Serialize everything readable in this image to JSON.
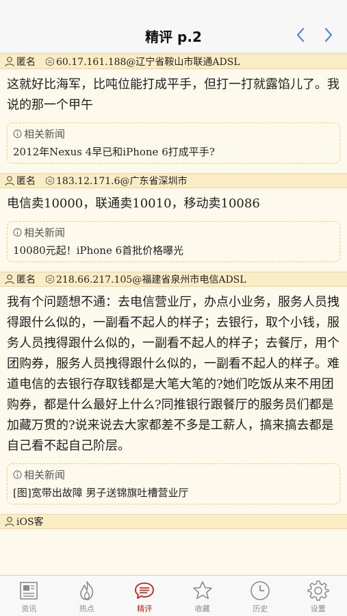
{
  "header": {
    "title": "精评 p.2"
  },
  "comments": [
    {
      "user": "匿名",
      "location": "60.17.161.188@辽宁省鞍山市联通ADSL",
      "text": "这就好比海军，比吨位能打成平手，但打一打就露馅儿了。我说的那一个甲午",
      "related_label": "相关新闻",
      "related_title": "2012年Nexus 4早已和iPhone 6打成平手?"
    },
    {
      "user": "匿名",
      "location": "183.12.171.6@广东省深圳市",
      "text": "电信卖10000，联通卖10010，移动卖10086",
      "related_label": "相关新闻",
      "related_title": "10080元起！iPhone 6首批价格曝光"
    },
    {
      "user": "匿名",
      "location": "218.66.217.105@福建省泉州市电信ADSL",
      "text": "我有个问题想不通：去电信营业厅，办点小业务，服务人员拽得跟什么似的，一副看不起人的样子；去银行，取个小钱，服务人员拽得跟什么似的，一副看不起人的样子；去餐厅，用个团购券，服务人员拽得跟什么似的，一副看不起人的样子。难道电信的去银行存取钱都是大笔大笔的?她们吃饭从来不用团购券，都是什么最好上什么?同推银行跟餐厅的服务员们都是加藏万贯的?说来说去大家都差不多是工薪人，搞来搞去都是自己看不起自己阶层。",
      "related_label": "相关新闻",
      "related_title": "[图]宽带出故障 男子送锦旗吐槽营业厅"
    },
    {
      "user": "iOS客"
    }
  ],
  "tabs": [
    {
      "label": "资讯",
      "icon": "newspaper-icon"
    },
    {
      "label": "热点",
      "icon": "flame-icon"
    },
    {
      "label": "精评",
      "icon": "comment-bubble-icon",
      "active": true
    },
    {
      "label": "收藏",
      "icon": "star-icon"
    },
    {
      "label": "历史",
      "icon": "clock-icon"
    },
    {
      "label": "设置",
      "icon": "gear-icon"
    }
  ],
  "colors": {
    "accent": "#c81e14",
    "meta_bg": "#faedc6",
    "page_bg": "#fdf9ec",
    "nav_arrow": "#4a8ad8"
  }
}
